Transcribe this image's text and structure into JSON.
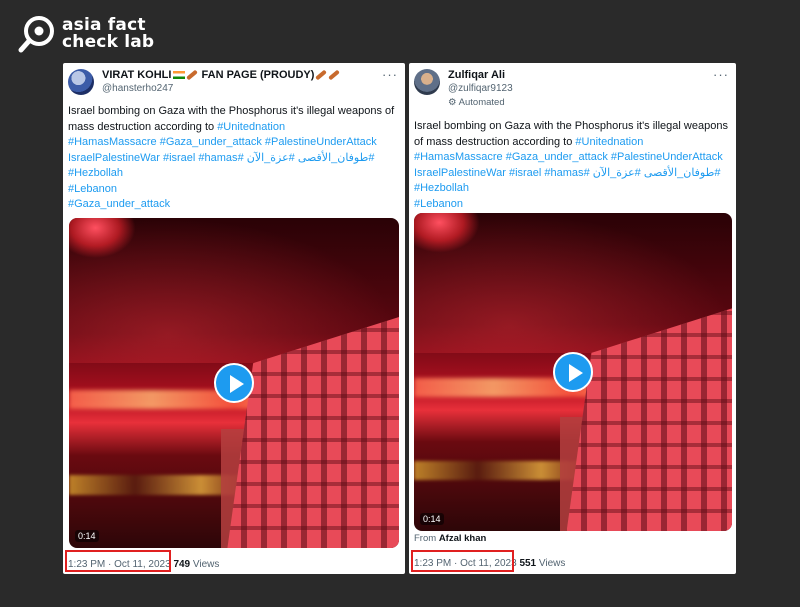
{
  "logo": {
    "line1": "asia fact",
    "line2": "check lab"
  },
  "tweets": [
    {
      "name": "VIRAT KOHLI",
      "name_suffix": "FAN PAGE (PROUDY)",
      "handle": "@hansterho247",
      "automated": "",
      "text_plain": "Israel bombing on Gaza with the Phosphorus it's illegal weapons of mass destruction according to ",
      "hashtags": {
        "l0": "#Unitednation",
        "l1": "#HamasMassacre #Gaza_under_attack #PalestineUnderAttack",
        "l2": "#طوفان_الأقصى #عزة_الآن #IsraelPalestineWar #israel #hamas",
        "l3": "#Hezbollah",
        "l4": "#Lebanon",
        "l5": "#Gaza_under_attack"
      },
      "duration": "0:14",
      "from": "",
      "time": "1:23 PM · Oct 11, 2023",
      "views_count": "749",
      "views_label": "Views"
    },
    {
      "name": "Zulfiqar Ali",
      "name_suffix": "",
      "handle": "@zulfiqar9123",
      "automated": "Automated",
      "text_plain": "Israel bombing on Gaza with the Phosphorus it's illegal weapons of mass destruction according to ",
      "hashtags": {
        "l0": "#Unitednation",
        "l1": "#HamasMassacre #Gaza_under_attack #PalestineUnderAttack",
        "l2": "#طوفان_الأقصى #عزة_الآن #IsraelPalestineWar #israel #hamas",
        "l3": "#Hezbollah",
        "l4": "#Lebanon",
        "l5": ""
      },
      "duration": "0:14",
      "from_label": "From",
      "from": "Afzal khan",
      "time": "1:23 PM · Oct 11, 2023",
      "views_count": "551",
      "views_label": "Views"
    }
  ],
  "colors": {
    "link": "#1d9bf0",
    "highlight": "#e02020",
    "background": "#2a2a2a"
  },
  "icons": {
    "more": "more-icon",
    "play": "play-icon",
    "automated": "robot-icon"
  }
}
